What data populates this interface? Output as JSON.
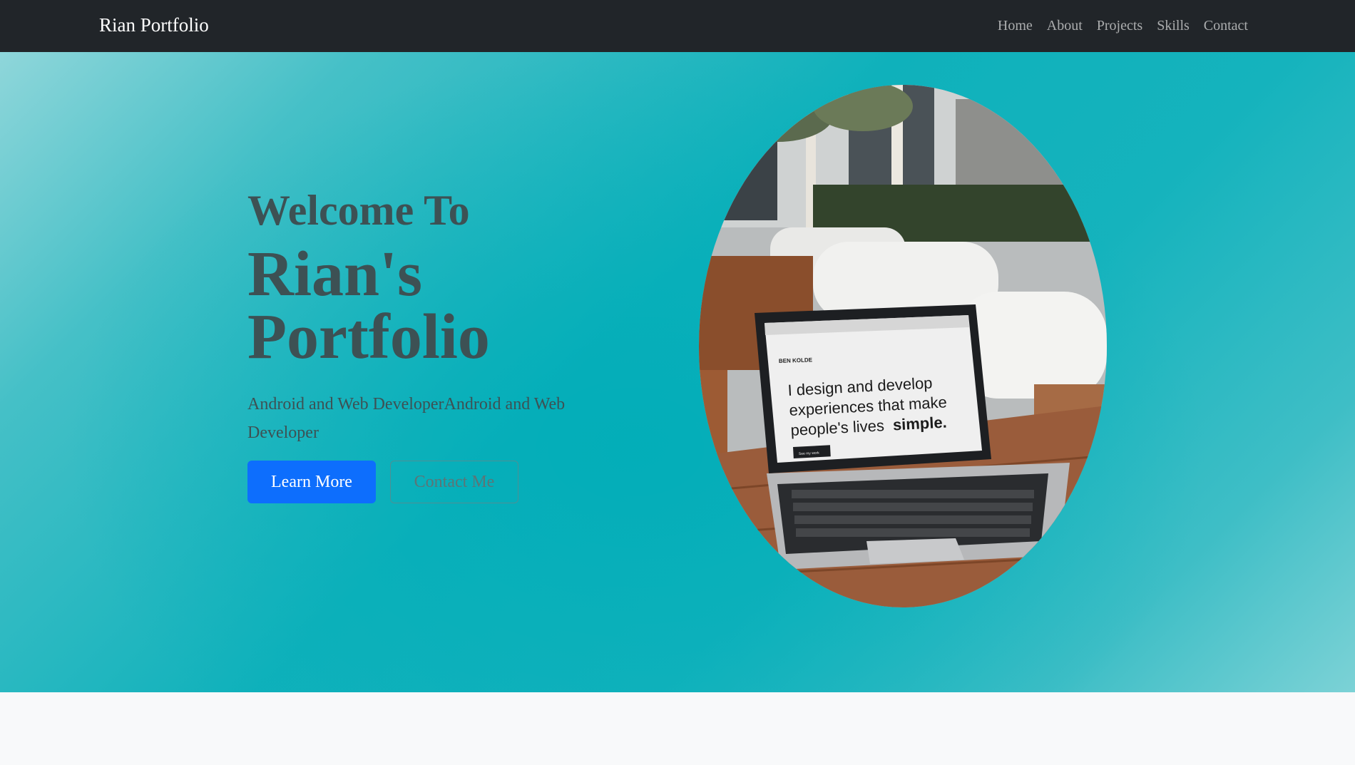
{
  "navbar": {
    "brand": "Rian Portfolio",
    "links": [
      "Home",
      "About",
      "Projects",
      "Skills",
      "Contact"
    ]
  },
  "hero": {
    "welcome": "Welcome To",
    "title_line1": "Rian's",
    "title_line2": "Portfolio",
    "tagline": "Android and Web DeveloperAndroid and Web Developer",
    "learn_more_label": "Learn More",
    "contact_me_label": "Contact Me",
    "image": {
      "screen_line1": "I design and develop",
      "screen_line2": "experiences that make",
      "screen_line3_prefix": "people's lives",
      "screen_line3_bold": "simple.",
      "screen_site_name": "BEN KOLDE",
      "screen_button": "See my work"
    }
  },
  "colors": {
    "navbar_bg": "#212529",
    "hero_teal": "#0fb1bb",
    "heading_text": "#3d5154",
    "primary_button": "#0d6efd",
    "page_bg": "#f8f9fa"
  }
}
